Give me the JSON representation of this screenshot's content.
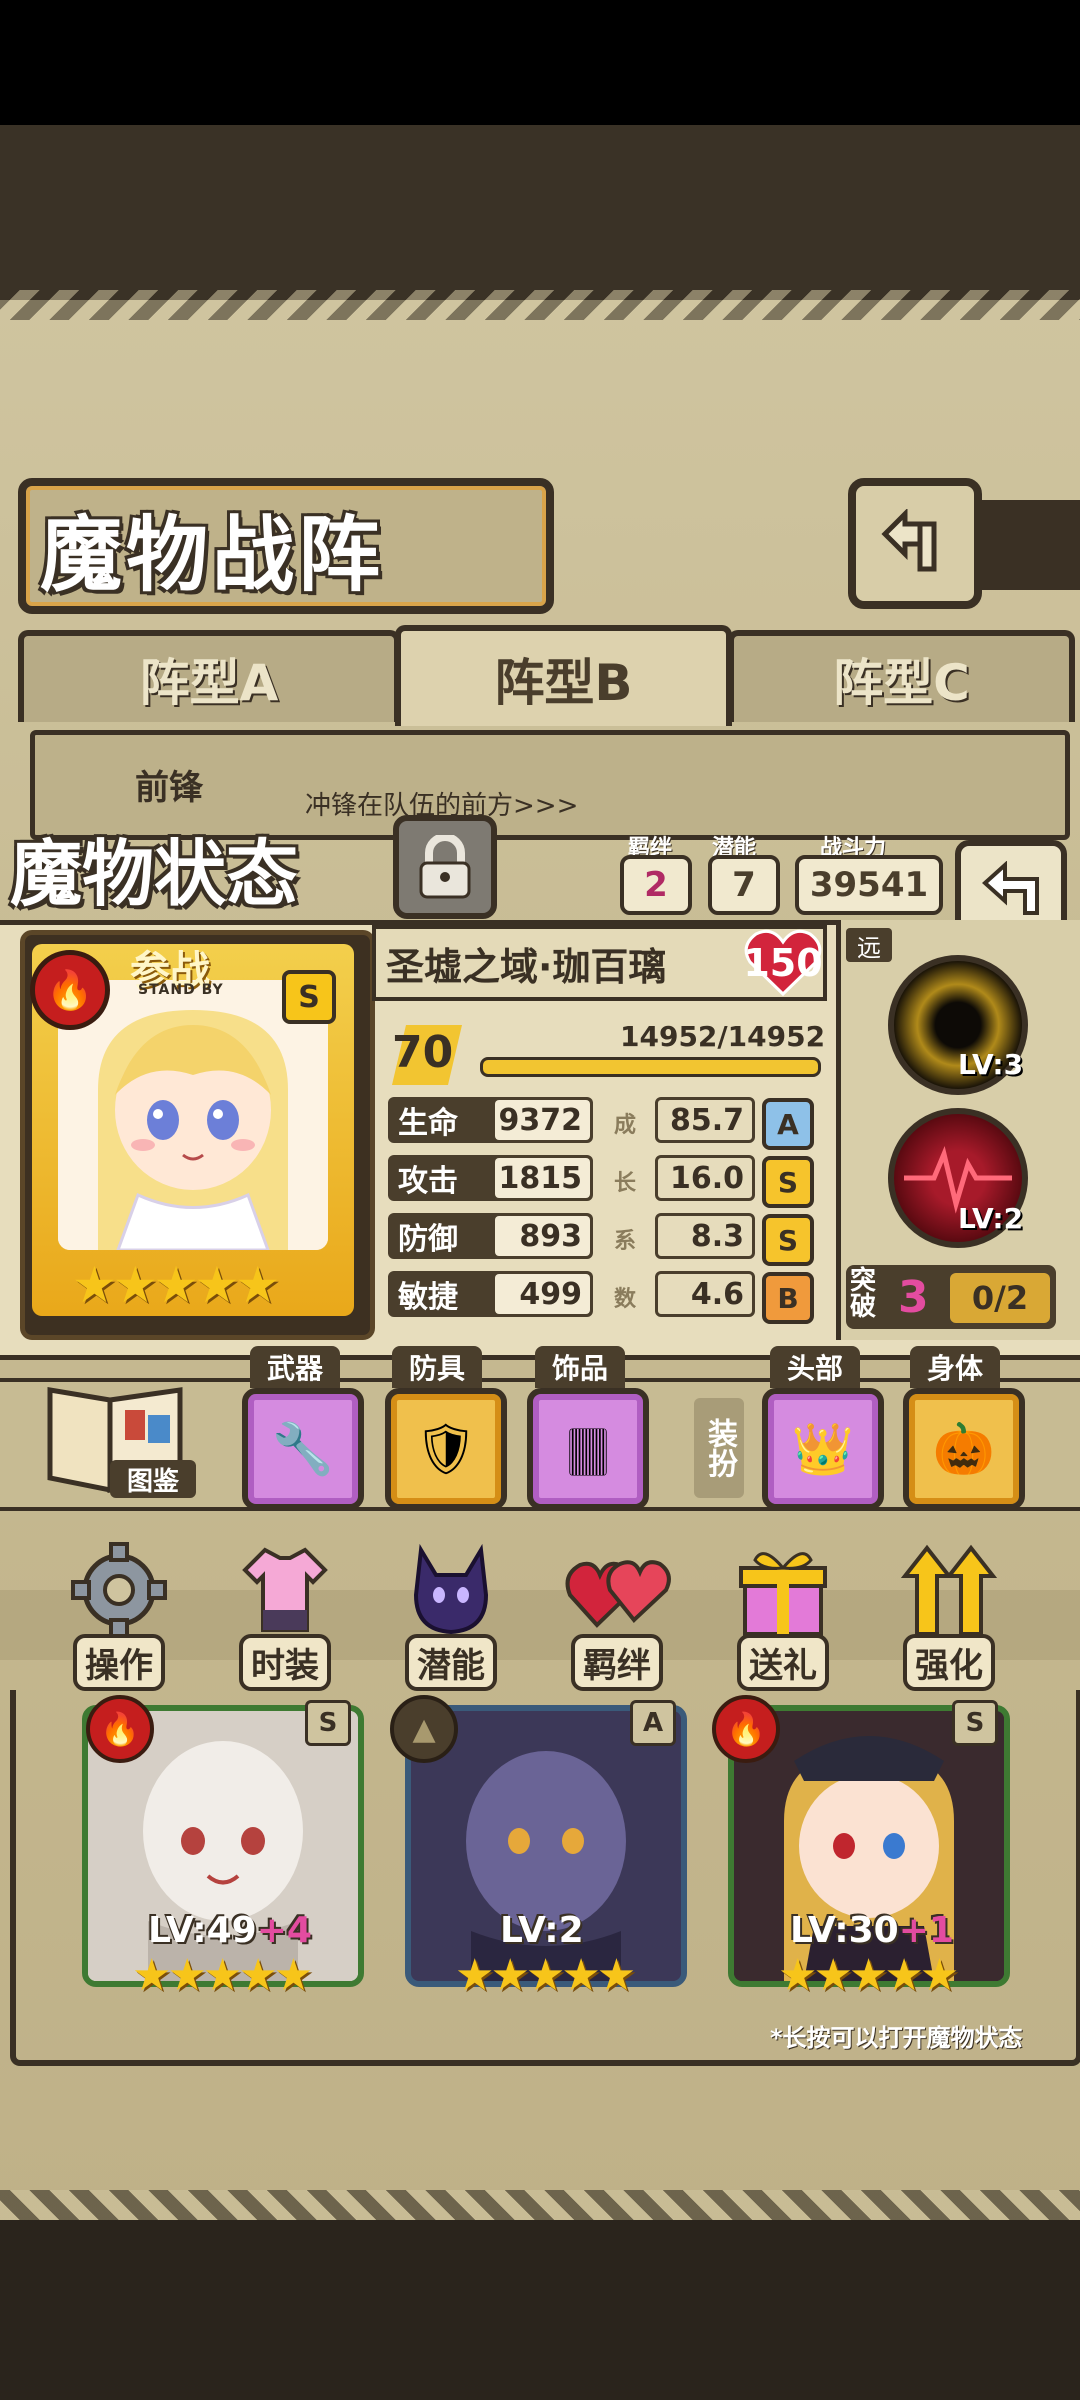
{
  "header": {
    "title": "魔物战阵",
    "tabs": [
      {
        "label": "阵型A",
        "active": false
      },
      {
        "label": "阵型B",
        "active": true
      },
      {
        "label": "阵型C",
        "active": false
      }
    ],
    "vanguard_label": "前锋",
    "vanguard_desc": "冲锋在队伍的前方>>>"
  },
  "status": {
    "title": "魔物状态",
    "bond_label": "羁绊",
    "bond_value": "2",
    "potential_label": "潜能",
    "potential_value": "7",
    "power_label": "战斗力",
    "power_value": "39541"
  },
  "monster": {
    "standby": "参战",
    "standby_en": "STAND BY",
    "rank_badge": "S",
    "element": "fire",
    "stars": "★★★★★",
    "name": "圣墟之域·珈百璃",
    "affection": "150",
    "level": "70",
    "hp": "14952/14952",
    "hp_fraction": 1.0,
    "stats": [
      {
        "label": "生命",
        "value": "9372",
        "growth": "85.7",
        "grade": "A"
      },
      {
        "label": "攻击",
        "value": "1815",
        "growth": "16.0",
        "grade": "S"
      },
      {
        "label": "防御",
        "value": "893",
        "growth": "8.3",
        "grade": "S"
      },
      {
        "label": "敏捷",
        "value": "499",
        "growth": "4.6",
        "grade": "B"
      }
    ],
    "growth_chars": [
      "成",
      "长",
      "系",
      "数"
    ]
  },
  "skills": {
    "range_label": "远",
    "skill1_lv": "LV:3",
    "skill2_lv": "LV:2",
    "break_label": "突破",
    "break_value": "3",
    "break_progress": "0/2"
  },
  "equipment": {
    "codex_label": "图鉴",
    "weapon_label": "武器",
    "armor_label": "防具",
    "accessory_label": "饰品",
    "dress_label": "装扮",
    "head_label": "头部",
    "body_label": "身体"
  },
  "menu": [
    {
      "label": "操作",
      "icon": "gear-icon"
    },
    {
      "label": "时装",
      "icon": "outfit-icon"
    },
    {
      "label": "潜能",
      "icon": "demon-icon"
    },
    {
      "label": "羁绊",
      "icon": "hearts-icon"
    },
    {
      "label": "送礼",
      "icon": "gift-icon"
    },
    {
      "label": "强化",
      "icon": "upgrade-arrows-icon"
    }
  ],
  "team": [
    {
      "lv": "LV:49",
      "plus": "+4",
      "stars": "★★★★★",
      "rank": "S"
    },
    {
      "lv": "LV:2",
      "plus": "",
      "stars": "★★★★★",
      "rank": "A"
    },
    {
      "lv": "LV:30",
      "plus": "+1",
      "stars": "★★★★★",
      "rank": "S"
    }
  ],
  "hint": "*长按可以打开魔物状态"
}
